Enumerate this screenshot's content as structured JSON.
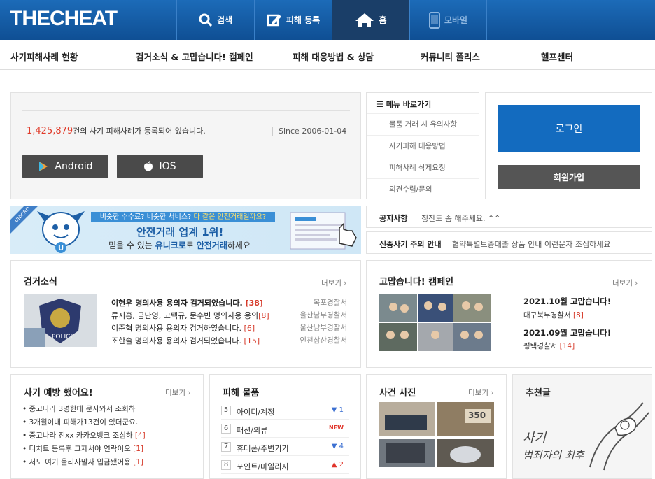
{
  "brand": {
    "logo_bold_a": "THE",
    "logo_bold_b": "CHEAT"
  },
  "topnav": [
    {
      "label": "검색",
      "icon": "search-icon"
    },
    {
      "label": "피해 등록",
      "icon": "edit-icon"
    },
    {
      "label": "홈",
      "icon": "home-icon"
    },
    {
      "label": "모바일",
      "icon": "mobile-icon"
    }
  ],
  "subnav": [
    "사기피해사례 현황",
    "검거소식 & 고맙습니다! 캠페인",
    "피해 대응방법 & 상담",
    "커뮤니티 폴리스",
    "헬프센터"
  ],
  "stats": {
    "count": "1,425,879",
    "suffix": "건의 사기 피해사례가 등록되어 있습니다.",
    "since": "Since 2006-01-04"
  },
  "apps": {
    "android": "Android",
    "ios": "IOS"
  },
  "quick_menu": {
    "title": "메뉴 바로가기",
    "items": [
      "물품 거래 시 유의사항",
      "사기피해 대응방법",
      "피해사례 삭제요청",
      "의견수렴/문의"
    ]
  },
  "auth": {
    "login": "로그인",
    "join": "회원가입"
  },
  "banner": {
    "ribbon": "UNICRO",
    "top_a": "비슷한 수수료? 비슷한 서비스?",
    "top_b": "다 같은 안전거래일까요?",
    "mid": "안전거래 업계 1위!",
    "bot_a": "믿을 수 있는",
    "bot_b": "유니크로",
    "bot_c": "로",
    "bot_d": "안전거래",
    "bot_e": "하세요"
  },
  "notices": [
    {
      "label": "공지사항",
      "text": "칭찬도 좀 해주세요. ^^"
    },
    {
      "label": "신종사기 주의 안내",
      "text": "협약특별보증대출 상품 안내 이런문자 조심하세요"
    }
  ],
  "arrest": {
    "title": "검거소식",
    "more": "더보기",
    "thumb_text": "POLICE",
    "items": [
      {
        "title": "이현우 명의사용 용의자 검거되었습니다.",
        "count": "[38]",
        "station": "목포경찰서"
      },
      {
        "title": "류지홍, 금난영, 고택규, 문수빈 명의사용 용의",
        "count": "[8]",
        "station": "울산남부경찰서"
      },
      {
        "title": "이준혁 명의사용 용의자 검거하였습니다.",
        "count": "[6]",
        "station": "울산남부경찰서"
      },
      {
        "title": "조한솔 명의사용 용의자 검거되었습니다.",
        "count": "[15]",
        "station": "인천삼산경찰서"
      }
    ]
  },
  "campaign": {
    "title": "고맙습니다! 캠페인",
    "more": "더보기",
    "items": [
      {
        "title": "2021.10월 고맙습니다!",
        "station": "대구북부경찰서",
        "count": "[8]"
      },
      {
        "title": "2021.09월 고맙습니다!",
        "station": "평택경찰서",
        "count": "[14]"
      }
    ]
  },
  "prevention": {
    "title": "사기 예방 했어요!",
    "more": "더보기",
    "items": [
      {
        "text": "중고나라 3명한테 문자와서 조회하",
        "count": ""
      },
      {
        "text": "3개월이내 피해가13건이 있더군요.",
        "count": ""
      },
      {
        "text": "중고나라 진xx 카카오뱅크 조심하",
        "count": "[4]"
      },
      {
        "text": "더치트 등록후 그제서야 연락이오",
        "count": "[1]"
      },
      {
        "text": "저도 여기 올리자말자 입금됐어용",
        "count": "[1]"
      }
    ]
  },
  "goods": {
    "title": "피해 물품",
    "items": [
      {
        "rank": "5",
        "label": "아이디/계정",
        "trend": "▼ 1",
        "color": "#3b6fd1"
      },
      {
        "rank": "6",
        "label": "패션/의류",
        "trend": "NEW",
        "color": "#e0342a"
      },
      {
        "rank": "7",
        "label": "휴대폰/주변기기",
        "trend": "▼ 4",
        "color": "#3b6fd1"
      },
      {
        "rank": "8",
        "label": "포인트/마일리지",
        "trend": "▲ 2",
        "color": "#e0342a"
      }
    ]
  },
  "photos": {
    "title": "사건 사진",
    "more": "더보기",
    "tag": "350"
  },
  "recommend": {
    "title": "추천글",
    "art_a": "사기",
    "art_b": "범죄자의 최후"
  }
}
